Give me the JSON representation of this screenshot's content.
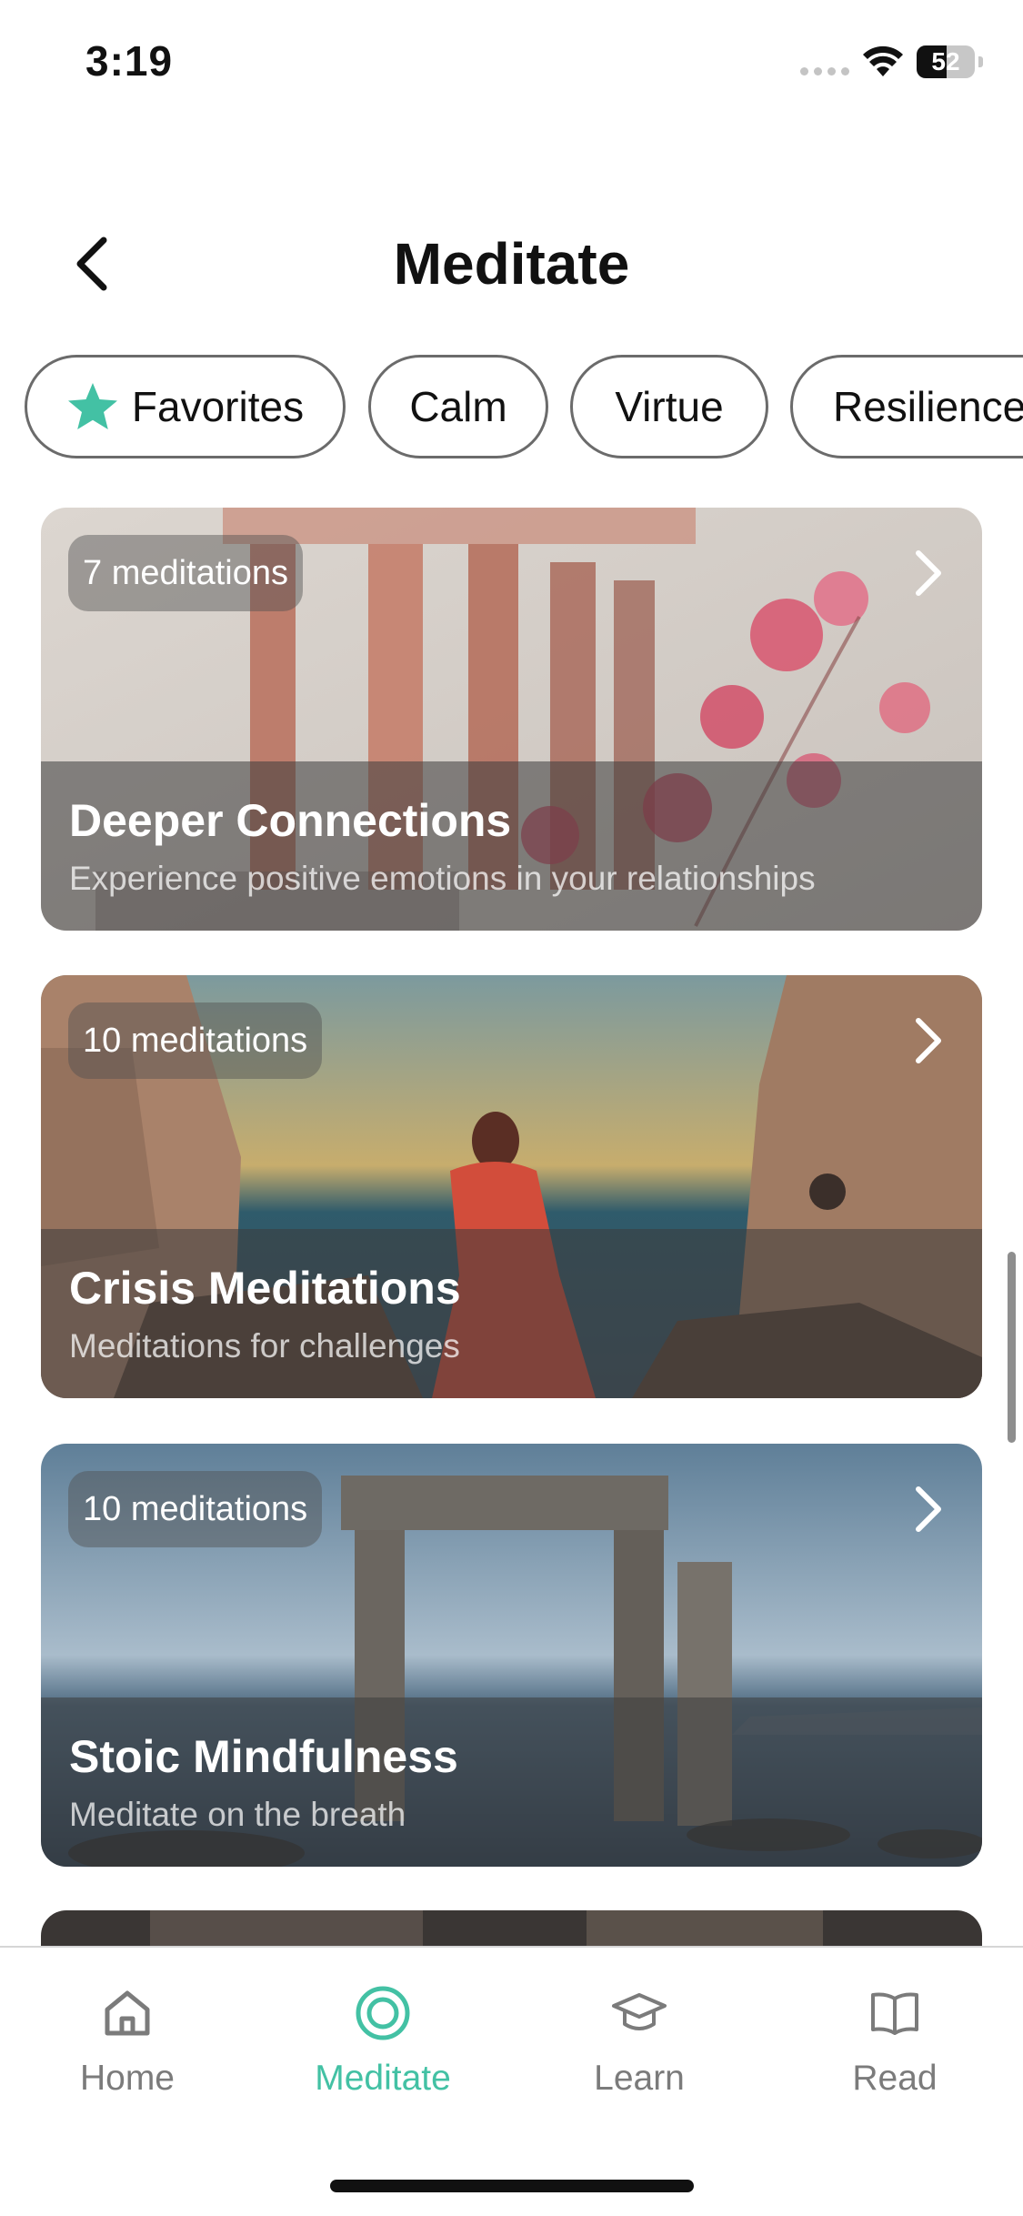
{
  "status_bar": {
    "time": "3:19",
    "battery": "52",
    "battery_level": 0.52
  },
  "header": {
    "title": "Meditate"
  },
  "filters": [
    {
      "label": "Favorites",
      "icon": "star-icon"
    },
    {
      "label": "Calm"
    },
    {
      "label": "Virtue"
    },
    {
      "label": "Resilience"
    }
  ],
  "cards": [
    {
      "badge": "7 meditations",
      "title": "Deeper Connections",
      "subtitle": "Experience positive emotions in your relationships"
    },
    {
      "badge": "10 meditations",
      "title": "Crisis Meditations",
      "subtitle": "Meditations for challenges"
    },
    {
      "badge": "10 meditations",
      "title": "Stoic Mindfulness",
      "subtitle": "Meditate on the breath"
    }
  ],
  "tabs": [
    {
      "label": "Home",
      "icon": "home-icon"
    },
    {
      "label": "Meditate",
      "icon": "meditate-icon",
      "active": true
    },
    {
      "label": "Learn",
      "icon": "graduation-cap-icon"
    },
    {
      "label": "Read",
      "icon": "book-icon"
    }
  ],
  "colors": {
    "accent": "#43c1a4",
    "chip_border": "#6b6b6b",
    "inactive_tab": "#7b7b7b"
  }
}
